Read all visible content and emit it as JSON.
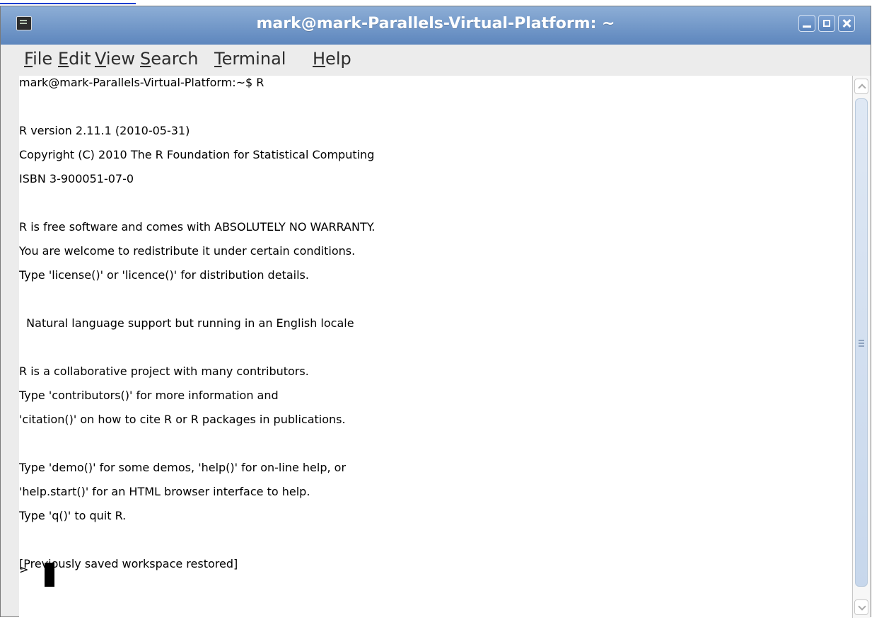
{
  "window": {
    "title": "mark@mark-Parallels-Virtual-Platform: ~"
  },
  "menu": {
    "items": [
      {
        "label": "File",
        "mnemonic": "F"
      },
      {
        "label": "Edit",
        "mnemonic": "E"
      },
      {
        "label": "View",
        "mnemonic": "V"
      },
      {
        "label": "Search",
        "mnemonic": "S"
      },
      {
        "label": "Terminal",
        "mnemonic": "T"
      },
      {
        "label": "Help",
        "mnemonic": "H"
      }
    ]
  },
  "terminal": {
    "lines": [
      "mark@mark-Parallels-Virtual-Platform:~$ R",
      "",
      "R version 2.11.1 (2010-05-31)",
      "Copyright (C) 2010 The R Foundation for Statistical Computing",
      "ISBN 3-900051-07-0",
      "",
      "R is free software and comes with ABSOLUTELY NO WARRANTY.",
      "You are welcome to redistribute it under certain conditions.",
      "Type 'license()' or 'licence()' for distribution details.",
      "",
      "  Natural language support but running in an English locale",
      "",
      "R is a collaborative project with many contributors.",
      "Type 'contributors()' for more information and",
      "'citation()' on how to cite R or R packages in publications.",
      "",
      "Type 'demo()' for some demos, 'help()' for on-line help, or",
      "'help.start()' for an HTML browser interface to help.",
      "Type 'q()' to quit R.",
      "",
      "[Previously saved workspace restored]",
      "",
      ">"
    ]
  }
}
